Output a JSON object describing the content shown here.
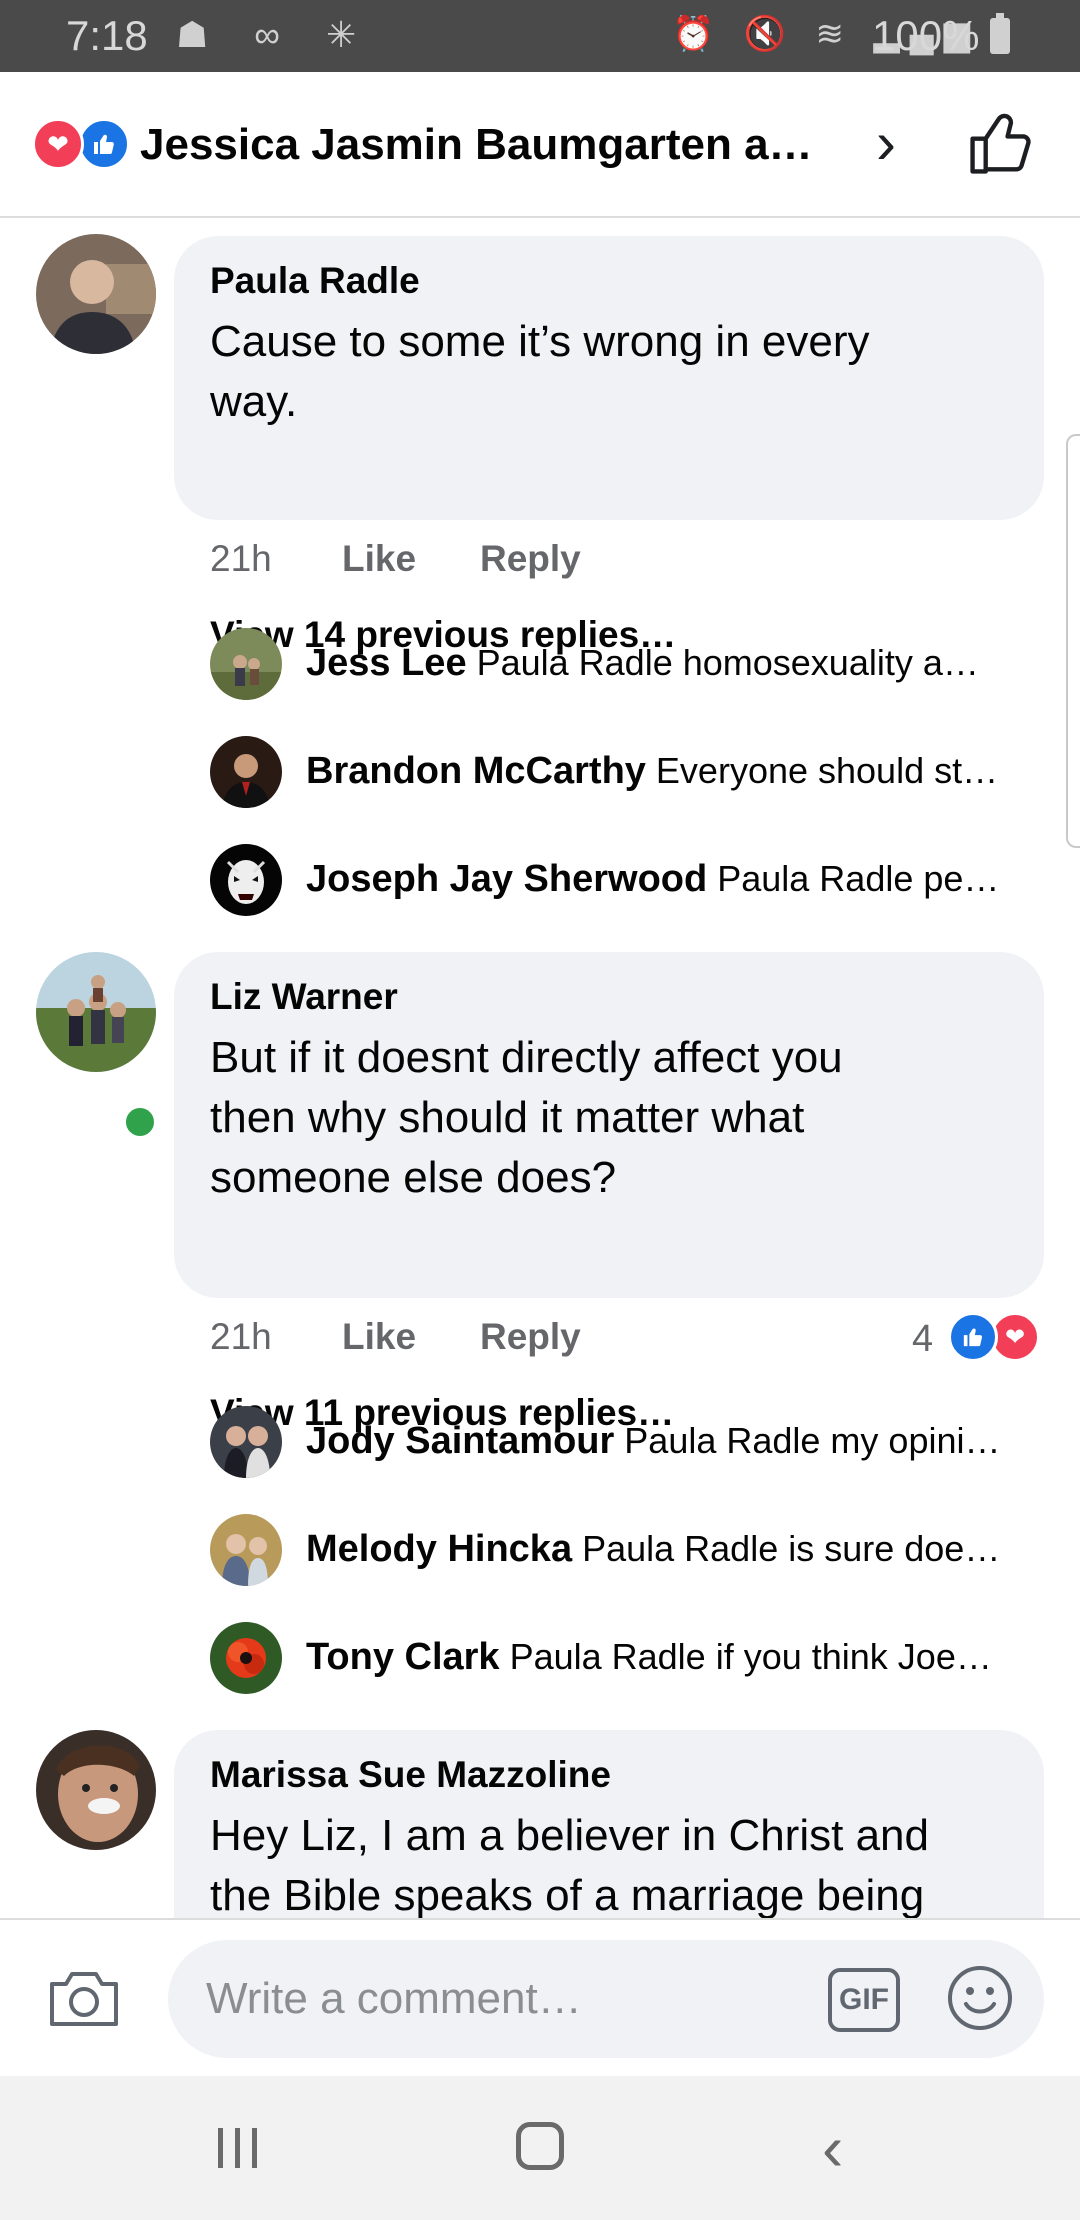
{
  "status_bar": {
    "time": "7:18",
    "left_icons": "☗ ∞ ✳",
    "right_icons": "⏰ 🔇 ≋ ▂▄▆",
    "battery": "100%"
  },
  "header": {
    "title": "Jessica Jasmin Baumgarten a…",
    "heart_icon": "❤",
    "like_icon": "👍",
    "chevron": "›"
  },
  "comments": [
    {
      "name": "Paula Radle",
      "text": "Cause to some it’s wrong in every\nway.",
      "time": "21h",
      "like": "Like",
      "reply": "Reply",
      "view_previous": "View 14 previous replies…",
      "replies": [
        {
          "name": "Jess Lee",
          "text": "Paula Radle  homosexuality a…"
        },
        {
          "name": "Brandon McCarthy",
          "text": "Everyone should st…"
        },
        {
          "name": "Joseph Jay Sherwood",
          "text": "Paula Radle pe…"
        }
      ]
    },
    {
      "name": "Liz Warner",
      "text": "But if it doesnt directly affect you\nthen why should it matter what\nsomeone else does?",
      "time": "21h",
      "like": "Like",
      "reply": "Reply",
      "reaction_count": "4",
      "view_previous": "View 11 previous replies…",
      "replies": [
        {
          "name": "Jody Saintamour",
          "text": "Paula Radle my opini…"
        },
        {
          "name": "Melody Hincka",
          "text": "Paula Radle is sure doe…"
        },
        {
          "name": "Tony Clark",
          "text": "Paula Radle if you think Joe…"
        }
      ]
    },
    {
      "name": "Marissa Sue Mazzoline",
      "text": "Hey Liz, I am a believer in Christ and\nthe Bible speaks of a marriage being"
    }
  ],
  "composer": {
    "placeholder": "Write a comment…",
    "gif_label": "GIF"
  },
  "colors": {
    "bubble": "#f0f2f5",
    "like_blue": "#1b74e4",
    "love_red": "#f33e58",
    "online_green": "#31a24c",
    "meta_gray": "#65676b"
  }
}
